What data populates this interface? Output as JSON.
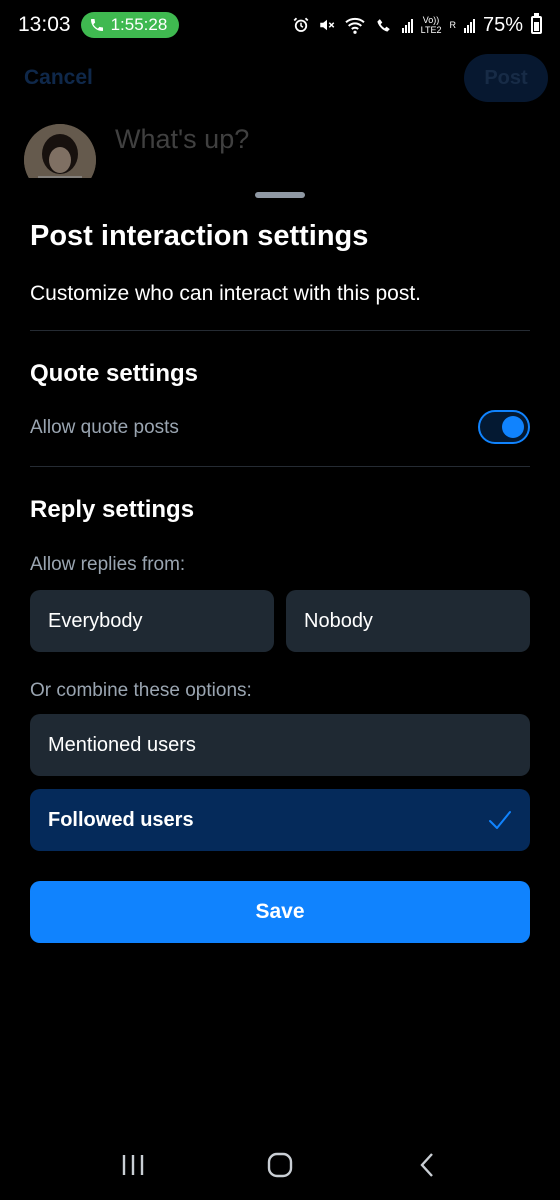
{
  "status_bar": {
    "time": "13:03",
    "call_duration": "1:55:28",
    "network_label": "LTE2",
    "volte_label": "Vo))",
    "roaming_label": "R",
    "battery_percent": "75%"
  },
  "composer": {
    "cancel_label": "Cancel",
    "post_label": "Post",
    "placeholder": "What's up?"
  },
  "sheet": {
    "title": "Post interaction settings",
    "subtitle": "Customize who can interact with this post.",
    "quote_settings": {
      "title": "Quote settings",
      "toggle_label": "Allow quote posts",
      "toggle_on": true
    },
    "reply_settings": {
      "title": "Reply settings",
      "allow_from_label": "Allow replies from:",
      "options": [
        "Everybody",
        "Nobody"
      ],
      "combine_label": "Or combine these options:",
      "combine_options": [
        {
          "label": "Mentioned users",
          "selected": false
        },
        {
          "label": "Followed users",
          "selected": true
        }
      ]
    },
    "save_label": "Save"
  },
  "colors": {
    "accent": "#1083fe",
    "card": "#1f2933",
    "selected_card": "#052a5a",
    "call_pill": "#3fb950"
  },
  "icons": [
    "phone-icon",
    "alarm-icon",
    "mute-icon",
    "wifi-icon",
    "wifi-call-icon",
    "signal-icon",
    "battery-icon",
    "check-icon",
    "recent-apps-icon",
    "home-icon",
    "back-icon"
  ]
}
